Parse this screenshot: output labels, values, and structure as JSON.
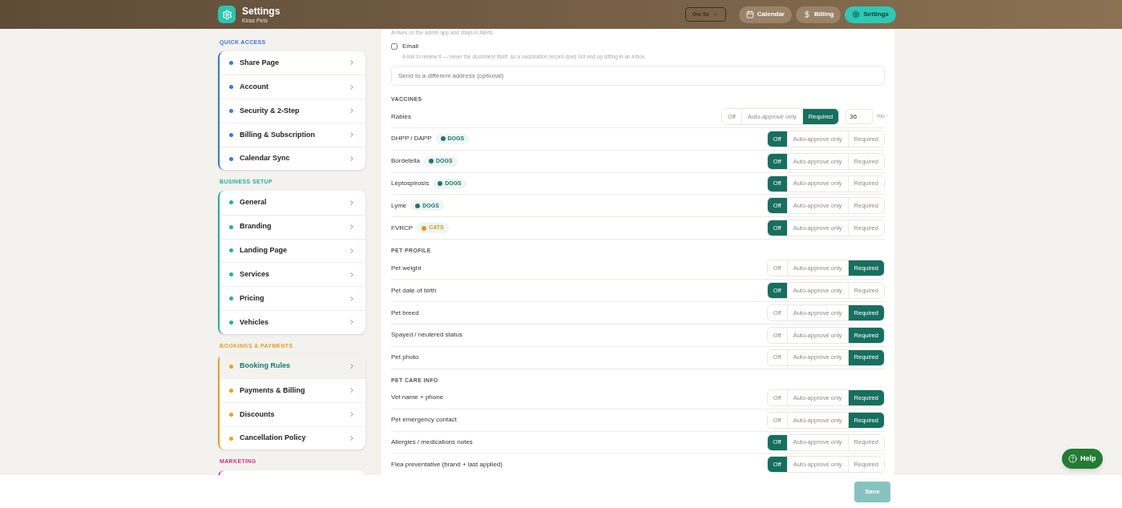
{
  "header": {
    "title": "Settings",
    "subtitle": "Kiras Pets",
    "goto": "Go to",
    "nav": [
      {
        "label": "Calendar",
        "selected": false
      },
      {
        "label": "Billing",
        "selected": false
      },
      {
        "label": "Settings",
        "selected": true
      }
    ]
  },
  "sidebar": [
    {
      "heading": "QUICK ACCESS",
      "color": "#3b78d4",
      "items": [
        {
          "label": "Share Page",
          "selected": false
        },
        {
          "label": "Account",
          "selected": false
        },
        {
          "label": "Security & 2-Step",
          "selected": false
        },
        {
          "label": "Billing & Subscription",
          "selected": false
        },
        {
          "label": "Calendar Sync",
          "selected": false
        }
      ]
    },
    {
      "heading": "BUSINESS SETUP",
      "color": "#28ae9c",
      "items": [
        {
          "label": "General",
          "selected": false
        },
        {
          "label": "Branding",
          "selected": false
        },
        {
          "label": "Landing Page",
          "selected": false
        },
        {
          "label": "Services",
          "selected": false
        },
        {
          "label": "Pricing",
          "selected": false
        },
        {
          "label": "Vehicles",
          "selected": false
        }
      ]
    },
    {
      "heading": "BOOKINGS & PAYMENTS",
      "color": "#e2a128",
      "items": [
        {
          "label": "Booking Rules",
          "selected": true
        },
        {
          "label": "Payments & Billing",
          "selected": false
        },
        {
          "label": "Discounts",
          "selected": false
        },
        {
          "label": "Cancellation Policy",
          "selected": false
        }
      ]
    },
    {
      "heading": "MARKETING",
      "color": "#d6317f"
    }
  ],
  "notify": {
    "top_note": "Arrives on the admin app and stays in Alerts.",
    "email": {
      "label": "Email",
      "checked": false,
      "note": "A link to review it — never the document itself, so a vaccination record does not end up sitting in an inbox."
    },
    "alt_address": {
      "placeholder": "Send to a different address (optional)"
    }
  },
  "sections": [
    {
      "heading": "VACCINES",
      "rows": [
        {
          "label": "Rabies",
          "options": [
            {
              "label": "Off",
              "selected": false
            },
            {
              "label": "Auto-approve only",
              "selected": false
            },
            {
              "label": "Required",
              "selected": true
            }
          ],
          "interval": {
            "value": "36",
            "unit": "mo"
          }
        },
        {
          "label": "DHPP / DAPP",
          "tag": {
            "label": "DOGS",
            "color": "#1d7a6b"
          },
          "options": [
            {
              "label": "Off",
              "selected": true
            },
            {
              "label": "Auto-approve only",
              "selected": false
            },
            {
              "label": "Required",
              "selected": false
            }
          ]
        },
        {
          "label": "Bordetella",
          "tag": {
            "label": "DOGS",
            "color": "#1d7a6b"
          },
          "options": [
            {
              "label": "Off",
              "selected": true
            },
            {
              "label": "Auto-approve only",
              "selected": false
            },
            {
              "label": "Required",
              "selected": false
            }
          ]
        },
        {
          "label": "Leptospirosis",
          "tag": {
            "label": "DOGS",
            "color": "#1d7a6b"
          },
          "options": [
            {
              "label": "Off",
              "selected": true
            },
            {
              "label": "Auto-approve only",
              "selected": false
            },
            {
              "label": "Required",
              "selected": false
            }
          ]
        },
        {
          "label": "Lyme",
          "tag": {
            "label": "DOGS",
            "color": "#1d7a6b"
          },
          "options": [
            {
              "label": "Off",
              "selected": true
            },
            {
              "label": "Auto-approve only",
              "selected": false
            },
            {
              "label": "Required",
              "selected": false
            }
          ]
        },
        {
          "label": "FVRCP",
          "tag": {
            "label": "CATS",
            "color": "#d99a1e"
          },
          "options": [
            {
              "label": "Off",
              "selected": true
            },
            {
              "label": "Auto-approve only",
              "selected": false
            },
            {
              "label": "Required",
              "selected": false
            }
          ]
        }
      ]
    },
    {
      "heading": "PET PROFILE",
      "rows": [
        {
          "label": "Pet weight",
          "options": [
            {
              "label": "Off",
              "selected": false
            },
            {
              "label": "Auto-approve only",
              "selected": false
            },
            {
              "label": "Required",
              "selected": true
            }
          ]
        },
        {
          "label": "Pet date of birth",
          "options": [
            {
              "label": "Off",
              "selected": true
            },
            {
              "label": "Auto-approve only",
              "selected": false
            },
            {
              "label": "Required",
              "selected": false
            }
          ]
        },
        {
          "label": "Pet breed",
          "options": [
            {
              "label": "Off",
              "selected": false
            },
            {
              "label": "Auto-approve only",
              "selected": false
            },
            {
              "label": "Required",
              "selected": true
            }
          ]
        },
        {
          "label": "Spayed / neutered status",
          "options": [
            {
              "label": "Off",
              "selected": false
            },
            {
              "label": "Auto-approve only",
              "selected": false
            },
            {
              "label": "Required",
              "selected": true
            }
          ]
        },
        {
          "label": "Pet photo",
          "options": [
            {
              "label": "Off",
              "selected": false
            },
            {
              "label": "Auto-approve only",
              "selected": false
            },
            {
              "label": "Required",
              "selected": true
            }
          ]
        }
      ]
    },
    {
      "heading": "PET CARE INFO",
      "rows": [
        {
          "label": "Vet name + phone",
          "options": [
            {
              "label": "Off",
              "selected": false
            },
            {
              "label": "Auto-approve only",
              "selected": false
            },
            {
              "label": "Required",
              "selected": true
            }
          ]
        },
        {
          "label": "Pet emergency contact",
          "options": [
            {
              "label": "Off",
              "selected": false
            },
            {
              "label": "Auto-approve only",
              "selected": false
            },
            {
              "label": "Required",
              "selected": true
            }
          ]
        },
        {
          "label": "Allergies / medications notes",
          "options": [
            {
              "label": "Off",
              "selected": true
            },
            {
              "label": "Auto-approve only",
              "selected": false
            },
            {
              "label": "Required",
              "selected": false
            }
          ]
        },
        {
          "label": "Flea preventative (brand + last applied)",
          "options": [
            {
              "label": "Off",
              "selected": true
            },
            {
              "label": "Auto-approve only",
              "selected": false
            },
            {
              "label": "Required",
              "selected": false
            }
          ]
        }
      ]
    }
  ],
  "footer": {
    "save": "Save"
  },
  "help": "Help"
}
